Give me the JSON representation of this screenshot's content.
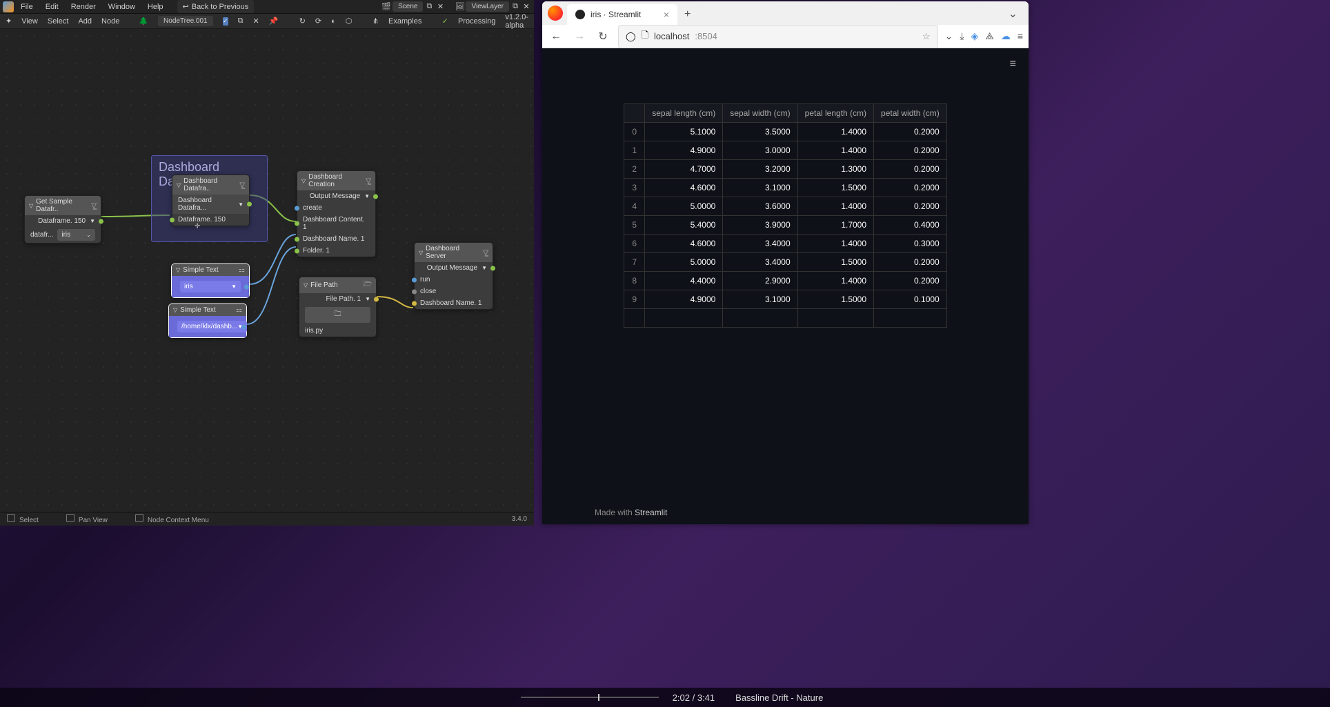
{
  "blender": {
    "menus": [
      "File",
      "Edit",
      "Render",
      "Window",
      "Help"
    ],
    "back_btn": "Back to Previous",
    "scene_label": "Scene",
    "viewlayer_label": "ViewLayer",
    "toolbar": {
      "view": "View",
      "select": "Select",
      "add": "Add",
      "node": "Node",
      "nodetree": "NodeTree.001",
      "examples": "Examples",
      "processing": "Processing",
      "version": "v1.2.0-alpha"
    },
    "frame_title": "Dashboard Dataframe",
    "nodes": {
      "get_sample": {
        "title": "Get Sample Datafr..",
        "output": "Dataframe. 150",
        "field_label": "datafr...",
        "field_value": "iris"
      },
      "dash_dataframe": {
        "title": "Dashboard Datafra..",
        "output": "Dashboard Datafra...",
        "input": "Dataframe. 150"
      },
      "simple_text_1": {
        "title": "Simple Text",
        "value": "iris"
      },
      "simple_text_2": {
        "title": "Simple Text",
        "value": "/home/klx/dashb..."
      },
      "dash_creation": {
        "title": "Dashboard Creation",
        "output": "Output Message",
        "in1_label": "create",
        "in2": "Dashboard Content. 1",
        "in3": "Dashboard Name. 1",
        "in4": "Folder. 1"
      },
      "file_path": {
        "title": "File Path",
        "out": "File Path. 1",
        "text": "iris.py"
      },
      "dash_server": {
        "title": "Dashboard Server",
        "output": "Output Message",
        "in1_label": "run",
        "in2_label": "close",
        "in3": "Dashboard Name. 1"
      }
    },
    "status": {
      "select": "Select",
      "pan": "Pan View",
      "context": "Node Context Menu",
      "version": "3.4.0"
    }
  },
  "browser": {
    "tab_title": "iris · Streamlit",
    "url_host": "localhost",
    "url_port": ":8504",
    "made_with": "Made with ",
    "made_with_brand": "Streamlit"
  },
  "chart_data": {
    "type": "table",
    "columns": [
      "sepal length (cm)",
      "sepal width (cm)",
      "petal length (cm)",
      "petal width (cm)"
    ],
    "index": [
      "0",
      "1",
      "2",
      "3",
      "4",
      "5",
      "6",
      "7",
      "8",
      "9"
    ],
    "rows": [
      [
        "5.1000",
        "3.5000",
        "1.4000",
        "0.2000"
      ],
      [
        "4.9000",
        "3.0000",
        "1.4000",
        "0.2000"
      ],
      [
        "4.7000",
        "3.2000",
        "1.3000",
        "0.2000"
      ],
      [
        "4.6000",
        "3.1000",
        "1.5000",
        "0.2000"
      ],
      [
        "5.0000",
        "3.6000",
        "1.4000",
        "0.2000"
      ],
      [
        "5.4000",
        "3.9000",
        "1.7000",
        "0.4000"
      ],
      [
        "4.6000",
        "3.4000",
        "1.4000",
        "0.3000"
      ],
      [
        "5.0000",
        "3.4000",
        "1.5000",
        "0.2000"
      ],
      [
        "4.4000",
        "2.9000",
        "1.4000",
        "0.2000"
      ],
      [
        "4.9000",
        "3.1000",
        "1.5000",
        "0.1000"
      ]
    ]
  },
  "taskbar": {
    "time": "2:02 / 3:41",
    "track": "Bassline Drift - Nature"
  }
}
